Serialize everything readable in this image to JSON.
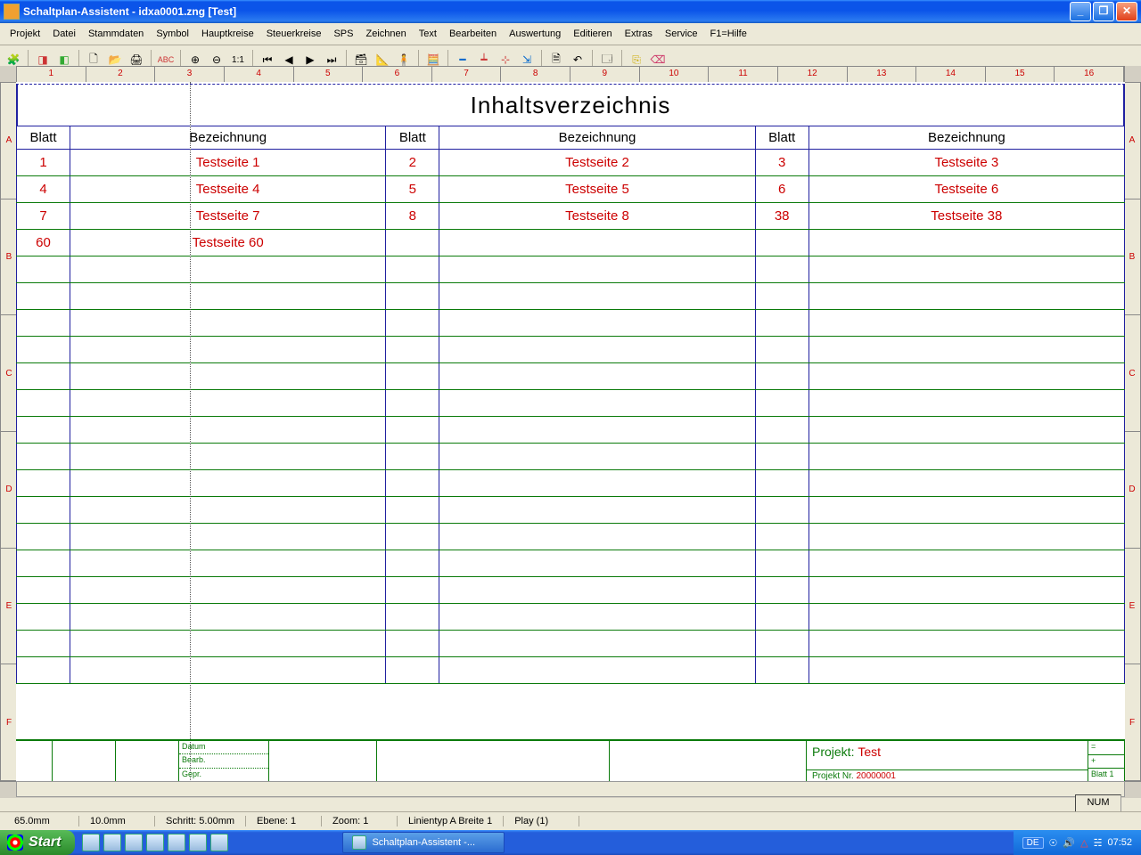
{
  "title": "Schaltplan-Assistent - idxa0001.zng [Test]",
  "menu": [
    "Projekt",
    "Datei",
    "Stammdaten",
    "Symbol",
    "Hauptkreise",
    "Steuerkreise",
    "SPS",
    "Zeichnen",
    "Text",
    "Bearbeiten",
    "Auswertung",
    "Editieren",
    "Extras",
    "Service",
    "F1=Hilfe"
  ],
  "ruler_h": [
    "1",
    "2",
    "3",
    "4",
    "5",
    "6",
    "7",
    "8",
    "9",
    "10",
    "11",
    "12",
    "13",
    "14",
    "15",
    "16"
  ],
  "ruler_v": [
    "A",
    "B",
    "C",
    "D",
    "E",
    "F"
  ],
  "page_title": "Inhaltsverzeichnis",
  "headers": {
    "sheet": "Blatt",
    "desc": "Bezeichnung"
  },
  "toc": [
    [
      {
        "s": "1",
        "d": "Testseite 1"
      },
      {
        "s": "2",
        "d": "Testseite 2"
      },
      {
        "s": "3",
        "d": "Testseite 3"
      }
    ],
    [
      {
        "s": "4",
        "d": "Testseite 4"
      },
      {
        "s": "5",
        "d": "Testseite 5"
      },
      {
        "s": "6",
        "d": "Testseite 6"
      }
    ],
    [
      {
        "s": "7",
        "d": "Testseite 7"
      },
      {
        "s": "8",
        "d": "Testseite 8"
      },
      {
        "s": "38",
        "d": "Testseite 38"
      }
    ],
    [
      {
        "s": "60",
        "d": "Testseite 60"
      },
      {
        "s": "",
        "d": ""
      },
      {
        "s": "",
        "d": ""
      }
    ]
  ],
  "empty_rows": 16,
  "footer": {
    "f1": "Datum",
    "f2": "Bearb.",
    "f3": "Gepr.",
    "proj_lbl": "Projekt:",
    "proj_val": "Test",
    "projnr_lbl": "Projekt Nr.",
    "projnr_val": "20000001",
    "blatt": "Blatt 1",
    "eq": "=",
    "plus": "+"
  },
  "num": "NUM",
  "status": {
    "x": "65.0mm",
    "y": "10.0mm",
    "step": "Schritt: 5.00mm",
    "layer": "Ebene: 1",
    "zoom": "Zoom: 1",
    "line": "Linientyp A Breite 1",
    "play": "Play (1)"
  },
  "start": "Start",
  "taskbtn": "Schaltplan-Assistent -...",
  "tray": {
    "lang": "DE",
    "clock": "07:52"
  }
}
